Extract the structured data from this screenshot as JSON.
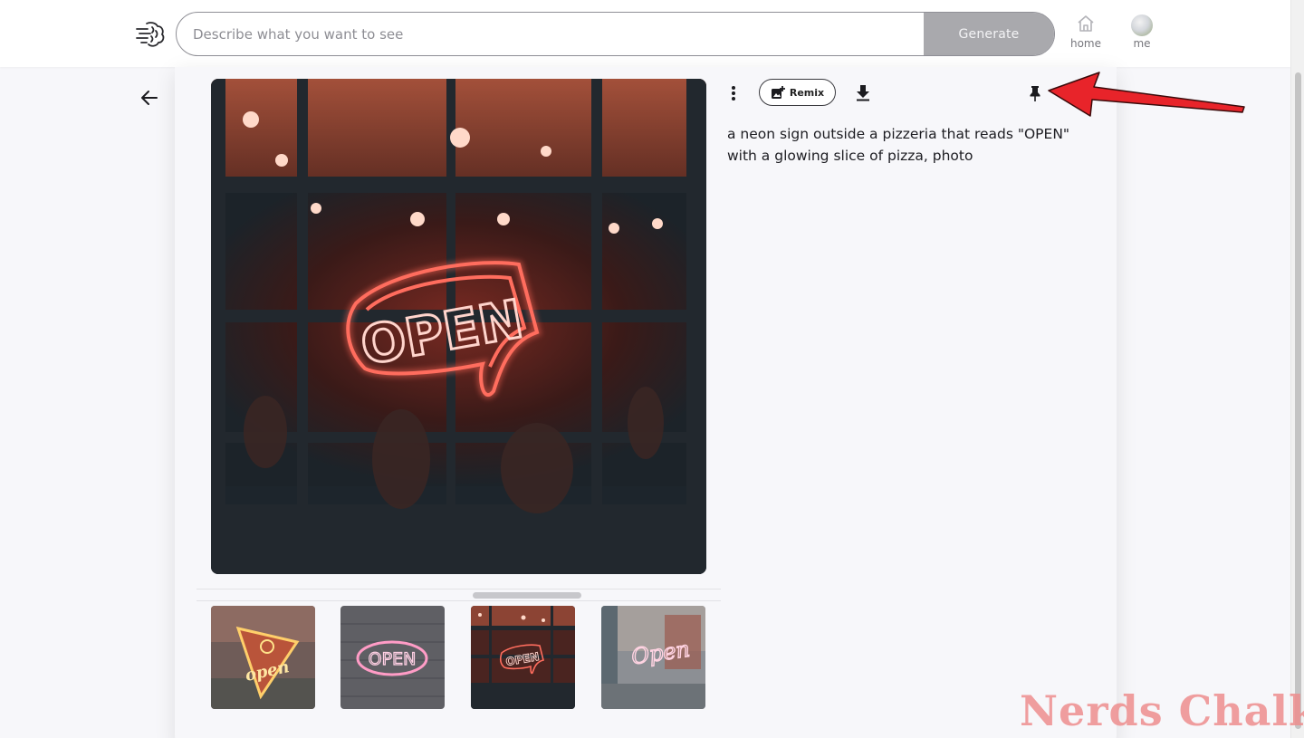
{
  "header": {
    "search": {
      "placeholder": "Describe what you want to see",
      "value": ""
    },
    "generate_label": "Generate",
    "nav": [
      {
        "label": "home",
        "icon": "home-icon"
      },
      {
        "label": "me",
        "icon": "avatar"
      }
    ]
  },
  "detail": {
    "actions": {
      "more_icon": "more-vertical-icon",
      "remix_label": "Remix",
      "download_icon": "download-icon",
      "pin_icon": "pin-icon"
    },
    "prompt": "a neon sign outside a pizzeria that reads \"OPEN\" with a glowing slice of pizza, photo",
    "main_image": {
      "sign_text": "OPEN"
    },
    "thumbnails": [
      {
        "sign_text": "open"
      },
      {
        "sign_text": "OPEN"
      },
      {
        "sign_text": "OPEN"
      },
      {
        "sign_text": "Open"
      }
    ]
  },
  "watermark": "Nerds Chalk",
  "colors": {
    "generate_bg": "#a9a9ad",
    "annotation_arrow": "#e8242a",
    "neon_red": "#ff5a4a",
    "neon_pink": "#ff8ab8",
    "watermark": "#ee8e8e"
  }
}
